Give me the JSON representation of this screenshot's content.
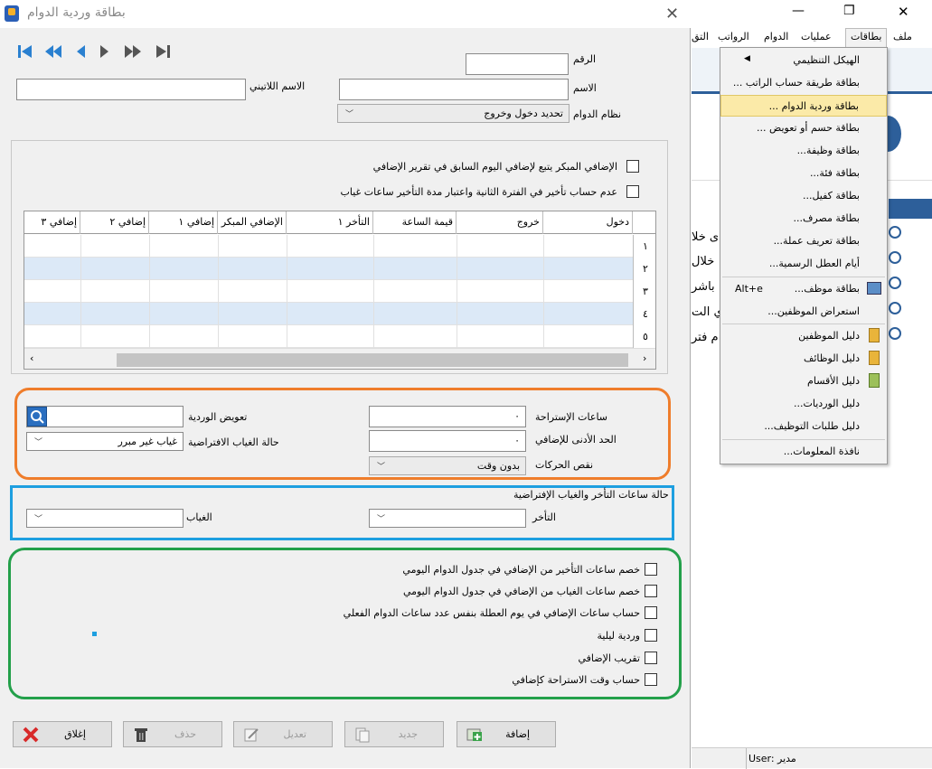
{
  "window": {
    "title": "بطاقة وردية الدوام"
  },
  "nav": {
    "first": "⏮",
    "prev_page": "⏪",
    "prev": "◀",
    "next": "▶",
    "next_page": "⏩",
    "last": "⏭"
  },
  "form": {
    "number_label": "الرقم",
    "number_value": "",
    "name_label": "الاسم",
    "name_value": "",
    "latin_name_label": "الاسم اللاتيني",
    "latin_name_value": "",
    "system_label": "نظام الدوام",
    "system_value": "تحديد دخول وخروج"
  },
  "options": {
    "early_overtime": "الإضافي المبكر يتبع لإضافي اليوم السابق في تقرير الإضافي",
    "no_late_second": "عدم حساب تأخير في الفترة الثانية واعتبار مدة التأخير ساعات غياب"
  },
  "grid": {
    "columns": [
      "دخول",
      "خروج",
      "قيمة الساعة",
      "التأخر ١",
      "الإضافي المبكر",
      "إضافي ١",
      "إضافي ٢",
      "إضافي ٣"
    ],
    "rows": [
      "١",
      "٢",
      "٣",
      "٤",
      "٥"
    ]
  },
  "orange": {
    "rest_hours_label": "ساعات الإستراحة",
    "rest_hours_value": "٠",
    "min_overtime_label": "الحد الأدنى للإضافي",
    "min_overtime_value": "٠",
    "movement_lack_label": "نقص الحركات",
    "movement_lack_value": "بدون وقت",
    "shift_comp_label": "تعويض الوردية",
    "shift_comp_value": "",
    "default_absence_label": "حالة الغياب الافتراضية",
    "default_absence_value": "غياب غير مبرر"
  },
  "blue": {
    "title": "حالة ساعات التأخر والغياب الإفتراضية",
    "late_label": "التأخر",
    "late_value": "",
    "absence_label": "الغياب",
    "absence_value": ""
  },
  "green": {
    "items": [
      "خصم ساعات التأخير من الإضافي في جدول الدوام اليومي",
      "خصم ساعات الغياب من الإضافي في جدول الدوام اليومي",
      "حساب ساعات الإضافي في يوم العطلة بنفس عدد ساعات الدوام الفعلي",
      "وردية ليلية",
      "تقريب الإضافي",
      "حساب وقت الاستراحة كإضافي"
    ]
  },
  "buttons": {
    "add": "إضافة",
    "new": "جديد",
    "edit": "تعديل",
    "delete": "حذف",
    "close": "إغلاق"
  },
  "menubar": {
    "items": [
      "ملف",
      "بطاقات",
      "عمليات",
      "الدوام",
      "الرواتب",
      "التق"
    ]
  },
  "dropdown": {
    "items": [
      "الهيكل التنظيمي",
      "بطاقة طريقة حساب الراتب ...",
      "بطاقة وردية الدوام ...",
      "بطاقة حسم أو تعويض ...",
      "بطاقة وظيفة...",
      "بطاقة فئة...",
      "بطاقة كفيل...",
      "بطاقة مصرف...",
      "بطاقة تعريف عملة...",
      "أيام العطل الرسمية...",
      "بطاقة موظف...",
      "استعراض الموظفين...",
      "دليل الموظفين",
      "دليل الوظائف",
      "دليل الأقسام",
      "دليل الورديات...",
      "دليل طلبات التوظيف...",
      "نافذة المعلومات..."
    ],
    "shortcut": "Alt+e"
  },
  "background_fragments": [
    "ى خلا",
    "خلال",
    "باشر",
    "ي الت",
    "م فتر"
  ],
  "status": {
    "user_label": "User:",
    "user_value": "مدير"
  },
  "window_controls": {
    "minimize": "—",
    "maximize": "❐",
    "close": "✕"
  }
}
